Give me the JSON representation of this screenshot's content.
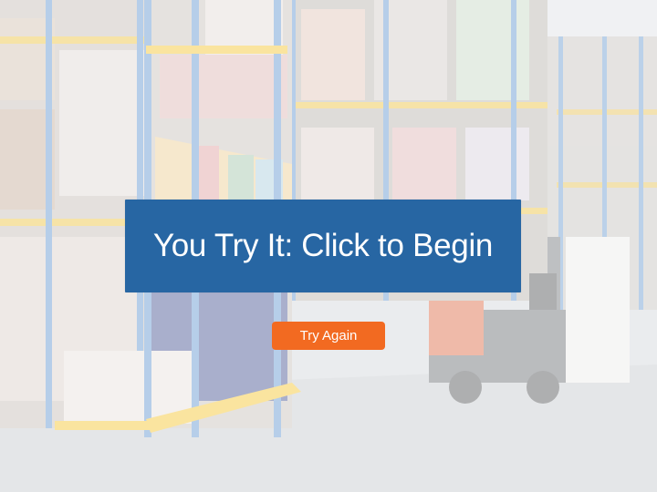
{
  "prompt": {
    "begin_label": "You Try It: Click to Begin",
    "retry_label": "Try Again"
  },
  "colors": {
    "begin_button": "#2766a3",
    "retry_button": "#f26a21",
    "rack_upright": "#3f7fc4",
    "rack_beam": "#f2b705"
  }
}
